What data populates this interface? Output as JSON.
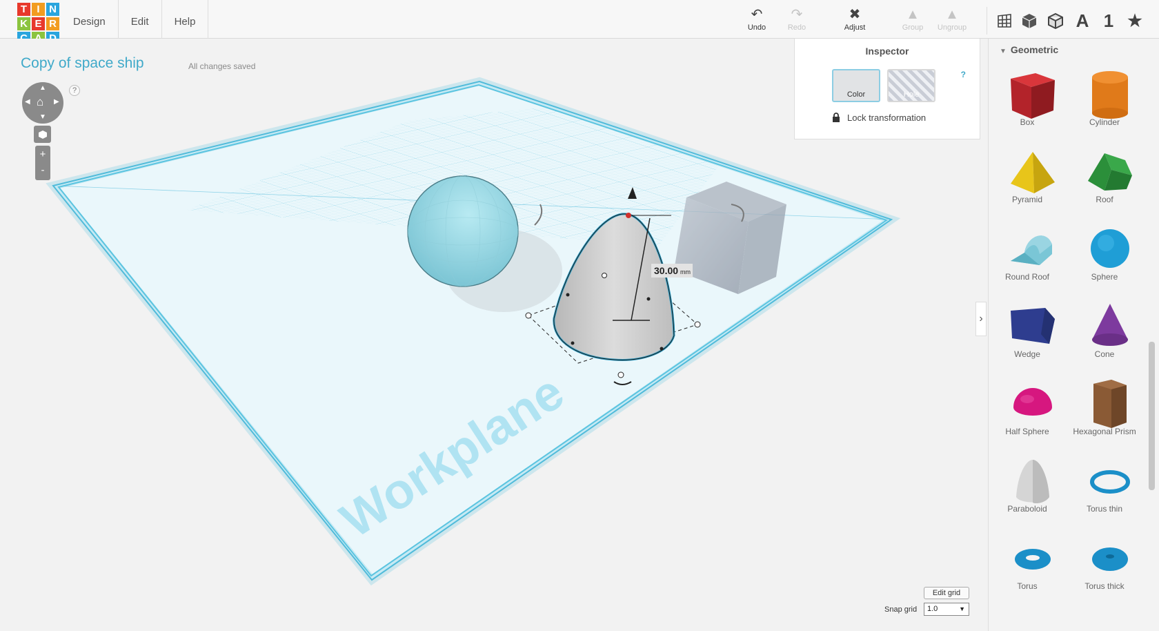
{
  "logo": {
    "letters": [
      "T",
      "I",
      "N",
      "K",
      "E",
      "R",
      "C",
      "A",
      "D"
    ],
    "colors": [
      "#e8392c",
      "#f29c20",
      "#2aa5de",
      "#8bc43f",
      "#e8392c",
      "#f29c20",
      "#2aa5de",
      "#8bc43f",
      "#2aa5de"
    ]
  },
  "menu": {
    "design": "Design",
    "edit": "Edit",
    "help": "Help"
  },
  "toolbar": {
    "undo": "Undo",
    "redo": "Redo",
    "adjust": "Adjust",
    "group": "Group",
    "ungroup": "Ungroup",
    "text_tool": "A",
    "number_tool": "1",
    "star_tool": "★"
  },
  "design": {
    "title": "Copy of space ship",
    "status": "All changes saved"
  },
  "inspector": {
    "title": "Inspector",
    "color_label": "Color",
    "hole_label": "Hole",
    "help": "?",
    "lock_label": "Lock transformation"
  },
  "navigation": {
    "help": "?",
    "zoom_in": "+",
    "zoom_out": "-"
  },
  "workplane": {
    "label": "Workplane",
    "dimension_value": "30.00",
    "dimension_unit": "mm"
  },
  "sidebar": {
    "category": "Geometric",
    "shapes": [
      {
        "label": "Box"
      },
      {
        "label": "Cylinder"
      },
      {
        "label": "Pyramid"
      },
      {
        "label": "Roof"
      },
      {
        "label": "Round Roof"
      },
      {
        "label": "Sphere"
      },
      {
        "label": "Wedge"
      },
      {
        "label": "Cone"
      },
      {
        "label": "Half Sphere"
      },
      {
        "label": "Hexagonal Prism"
      },
      {
        "label": "Paraboloid"
      },
      {
        "label": "Torus thin"
      },
      {
        "label": "Torus"
      },
      {
        "label": "Torus thick"
      }
    ]
  },
  "grid": {
    "edit_label": "Edit grid",
    "snap_label": "Snap grid",
    "snap_value": "1.0"
  },
  "colors": {
    "accent": "#3fa9c9",
    "grid_blue": "#5bc4e0"
  }
}
